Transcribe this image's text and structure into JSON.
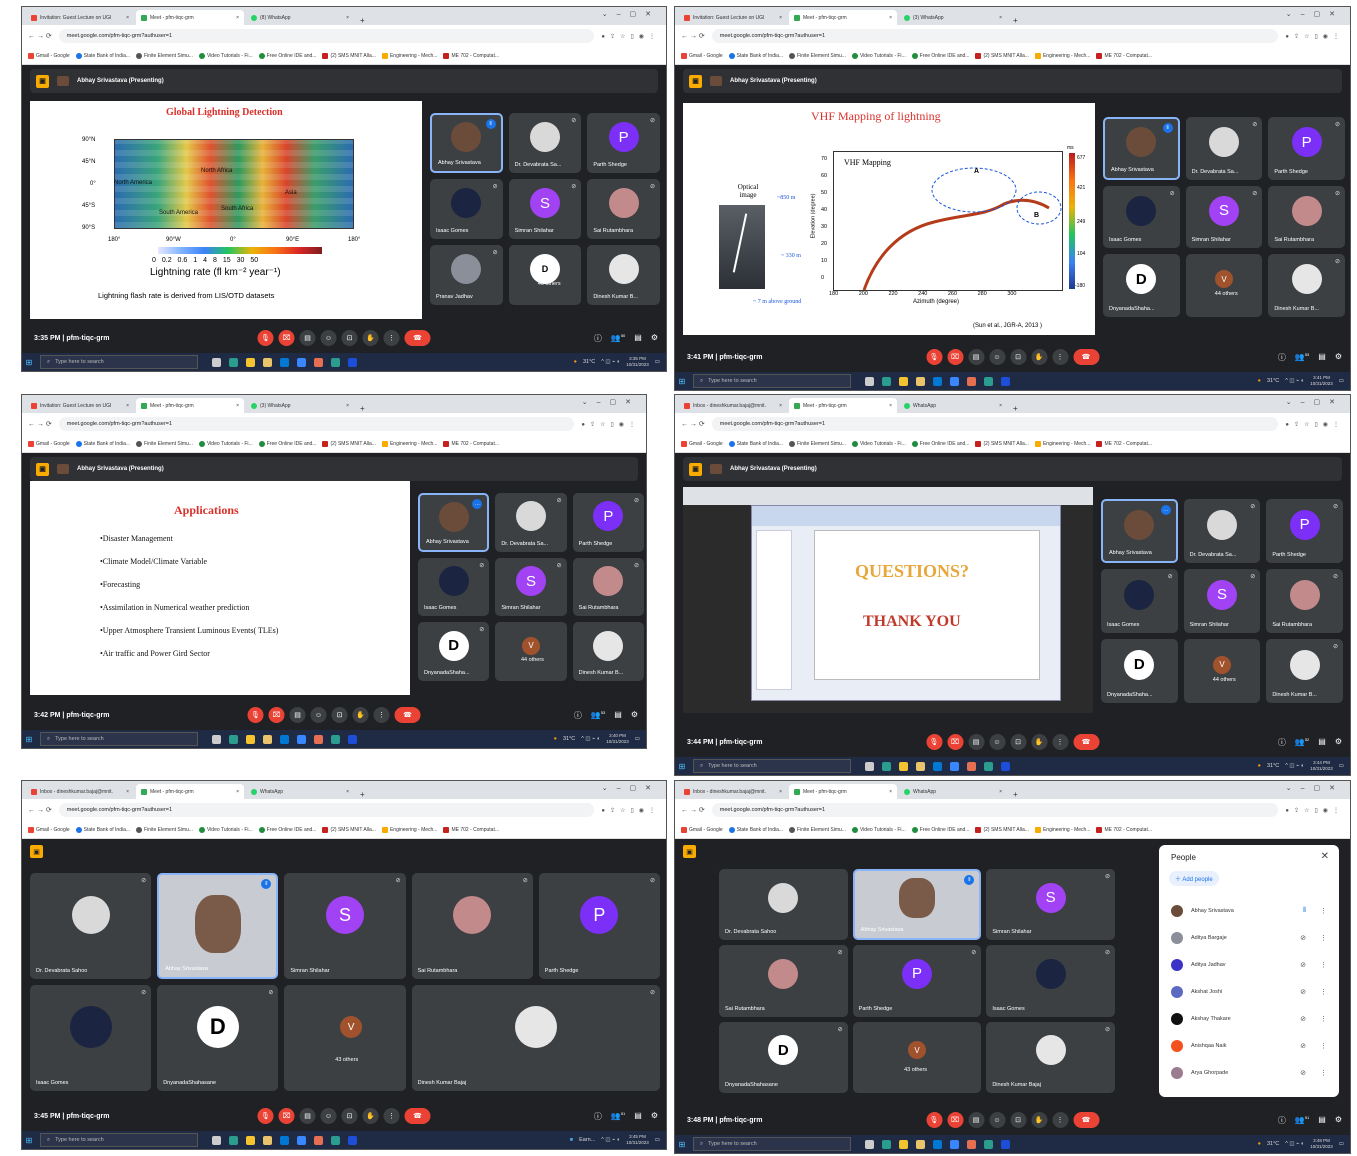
{
  "browser": {
    "tabs_first": [
      "Invitation: Guest Lecture on UGI",
      "Meet - pfm-tiqc-grm",
      "(8) WhatsApp"
    ],
    "tabs_second": [
      "Invitation: Guest Lecture on UGI",
      "Meet - pfm-tiqc-grm",
      "(3) WhatsApp"
    ],
    "tabs_inbox": [
      "Inbox - dineshkumar.bajaj@mnit.",
      "Meet - pfm-tiqc-grm",
      "WhatsApp"
    ],
    "url": "meet.google.com/pfm-tiqc-grm?authuser=1",
    "bookmarks": [
      "Gmail - Google",
      "State Bank of India...",
      "Finite Element Simu...",
      "Video Tutorials - Fi...",
      "Free Online IDE and...",
      "(2) SMS MNIT Alla...",
      "Engineering - Mech...",
      "ME 702 - Computat..."
    ],
    "close": "×",
    "new_tab": "+"
  },
  "meet": {
    "presenting": "Abhay Srivastava (Presenting)",
    "meeting_code": "pfm-tiqc-grm"
  },
  "participants": {
    "abhay": "Abhay Srivastava",
    "devabrata_short": "Dr. Devabrata Sa...",
    "devabrata": "Dr. Devabrata Sahoo",
    "parth": "Parth Shedge",
    "isaac": "Isaac Gomes",
    "simran": "Simran Shilahar",
    "sai": "Sai Rutambhara",
    "pranav": "Pranav Jadhav",
    "dinesh_short": "Dinesh Kumar B...",
    "dinesh": "Dinesh Kumar Bajaj",
    "dyan_short": "DnyanadaShaha...",
    "dyan": "DnyanadaShahasane",
    "others46": "46 others",
    "others44": "44 others",
    "others43": "43 others",
    "letter_p": "P",
    "letter_s": "S",
    "letter_v": "V",
    "letter_d": "D"
  },
  "times": {
    "t1": "3:35 PM",
    "t2": "3:41 PM",
    "t3": "3:42 PM",
    "t4": "3:44 PM",
    "t5": "3:45 PM",
    "t6": "3:48 PM"
  },
  "taskbar": {
    "search": "Type here to search",
    "temp": "31°C",
    "date": "10/31/2023",
    "clock1": "3:35 PM",
    "clock2": "3:41 PM",
    "clock3": "3:40 PM",
    "clock4": "3:44 PM",
    "clock5": "3:45 PM",
    "clock6": "3:48 PM",
    "earn": "Earn..."
  },
  "counts": {
    "c1": "50",
    "c2": "53",
    "c3": "53",
    "c4": "52",
    "c5": "51",
    "c6": "51"
  },
  "slide1": {
    "title": "Global Lightning Detection",
    "lat": [
      "90°N",
      "45°N",
      "0°",
      "45°S",
      "90°S"
    ],
    "lon": [
      "180°",
      "90°W",
      "0°",
      "90°E",
      "180°"
    ],
    "regions": [
      "North America",
      "South America",
      "North Africa",
      "South Africa",
      "Asia"
    ],
    "scale": [
      "0",
      "0.2",
      "0.6",
      "1",
      "4",
      "8",
      "15",
      "30",
      "50"
    ],
    "rate": "Lightning rate (fl km⁻² year⁻¹)",
    "caption": "Lightning flash rate is derived from LIS/OTD datasets"
  },
  "slide2": {
    "title": "VHF Mapping of lightning",
    "inner_title": "VHF Mapping",
    "optical": "Optical image",
    "m850": "~850 m",
    "m330": "~ 330 m",
    "ground": "~ 7 m above ground",
    "xlabel": "Azimuth (degree)",
    "ylabel": "Elevation (degree)",
    "cite": "(Sun et al., JGR-A, 2013 )",
    "ms": "ms",
    "a": "A",
    "b": "B",
    "cbar": [
      "677",
      "421",
      "249",
      "104",
      "-180"
    ],
    "xticks": [
      "180",
      "200",
      "220",
      "240",
      "260",
      "280",
      "300"
    ],
    "yticks": [
      "70",
      "60",
      "50",
      "40",
      "30",
      "20",
      "10",
      "0"
    ]
  },
  "slide3": {
    "title": "Applications",
    "items": [
      "•Disaster Management",
      "•Climate Model/Climate Variable",
      "•Forecasting",
      "•Assimilation in Numerical weather prediction",
      "•Upper Atmosphere Transient Luminous Events( TLEs)",
      "•Air traffic and Power Gird Sector"
    ]
  },
  "slide4": {
    "questions": "QUESTIONS?",
    "thanks": "THANK YOU"
  },
  "people_panel": {
    "title": "People",
    "add": "Add people",
    "list": [
      "Abhay Srivastava",
      "Aditya Bargaje",
      "Aditya Jadhav",
      "Akshat Joshi",
      "Akshay Thakare",
      "Anishqaa Naik",
      "Arya Ghorpade"
    ]
  },
  "colors": {
    "meet_bg": "#202124",
    "tile": "#3c4043",
    "red": "#ea4335",
    "accent": "#f9ab00",
    "slide_title": "#d9302b"
  }
}
